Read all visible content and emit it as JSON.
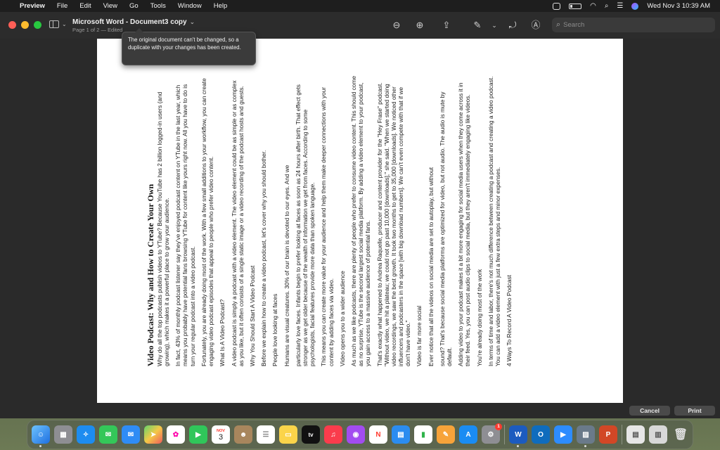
{
  "menubar": {
    "app_name": "Preview",
    "items": [
      "File",
      "Edit",
      "View",
      "Go",
      "Tools",
      "Window",
      "Help"
    ],
    "clock": "Wed Nov 3  10:39 AM"
  },
  "window": {
    "title": "Microsoft Word - Document3 copy",
    "subtitle": "Page 1 of 2 — Edited",
    "tooltip": "The original document can't be changed, so a duplicate with your changes has been created.",
    "search_placeholder": "Search"
  },
  "document": {
    "heading": "Video Podcast: Why and How to Create Your Own",
    "paragraphs": [
      "Why do all the top podcasts publish videos to YTube? Because YouTube has 2 billion logged-in users (and growing), which makes it a powerful place to grow your audience.",
      "In fact, 43% of monthly podcast listener say they've enjoyed podcast content on YTube in the last year, which means you probably have potential fans browsing YTube for content like yours right now. All you have to do is turn your regular podcast into a video podcast.",
      "Fortunately, you are already doing most of the work. With a few small additions to your workflow, you can create engaging video podcast episodes that appeal to people who prefer video content.",
      "What Is A Video Podcast?",
      "A video podcast is simply a podcast with a video element. The video element could be as simple or as complex as you like, but it often consists of a single static image or a video recording of the podcast hosts and guests.",
      "Why You Should Start A Video Podcast",
      "Before we explain how to create a video podcast, let's cover why you should bother.",
      "People love looking at faces",
      "Humans are visual creatures. 30% of our brain is devoted to our eyes. And we",
      "particularly love faces. Infants begin to prefer looking at faces as soon as 24 hours after birth. That effect gets stronger as we get older because of the wealth of information we get from faces. According to some psychologists, facial features provide more data than spoken language.",
      "This means you can create more value for your audience and help them make deeper connections with your content by adding faces via video.",
      "Video opens you to a wider audience",
      "As much as we like podcasts, there are plenty of people who prefer to consume video content. This should come as no surprise, YTube is the second largest social media platform. By adding a video element to your podcast, you gain access to a massive audience of potential fans.",
      "That's exactly what happened to Andrea Raquelle, producer and content provider for the \"Hey Frase\" podcast. \"Without video, we hit a plateau; we could not go past 10,000 [downloads],\" she said. \"When we started doing video recordings, we saw the best growth. It took two months to get to 35,000 [downloads]. We noticed other influencers and podcasters in the space [with big download numbers]. We can't even compete with that if we don't have video.\"",
      "Video is far more social",
      "Ever notice that all the videos on social media are set to autoplay, but without",
      "sound? That's because social media platforms are optimized for video, but not audio. The audio is mute by default.",
      "Adding video to your podcast makes it a bit more engaging for social media users when they come across it in their feed. Yes, you can post audio clips to social media, but they aren't immediately engaging like videos.",
      "You're already doing most of the work",
      "In terms of time and labor, there's not much difference between creating a podcast and creating a video podcast. You can add a video element with just a few extra steps and minor expenses.",
      "4 Ways To Record A Video Podcast"
    ]
  },
  "buttons": {
    "cancel": "Cancel",
    "print": "Print"
  },
  "dock": {
    "calendar_month": "NOV",
    "calendar_day": "3",
    "tv_label": "tv",
    "settings_badge": "1",
    "word_label": "W",
    "outlook_label": "O",
    "ppt_label": "P"
  }
}
